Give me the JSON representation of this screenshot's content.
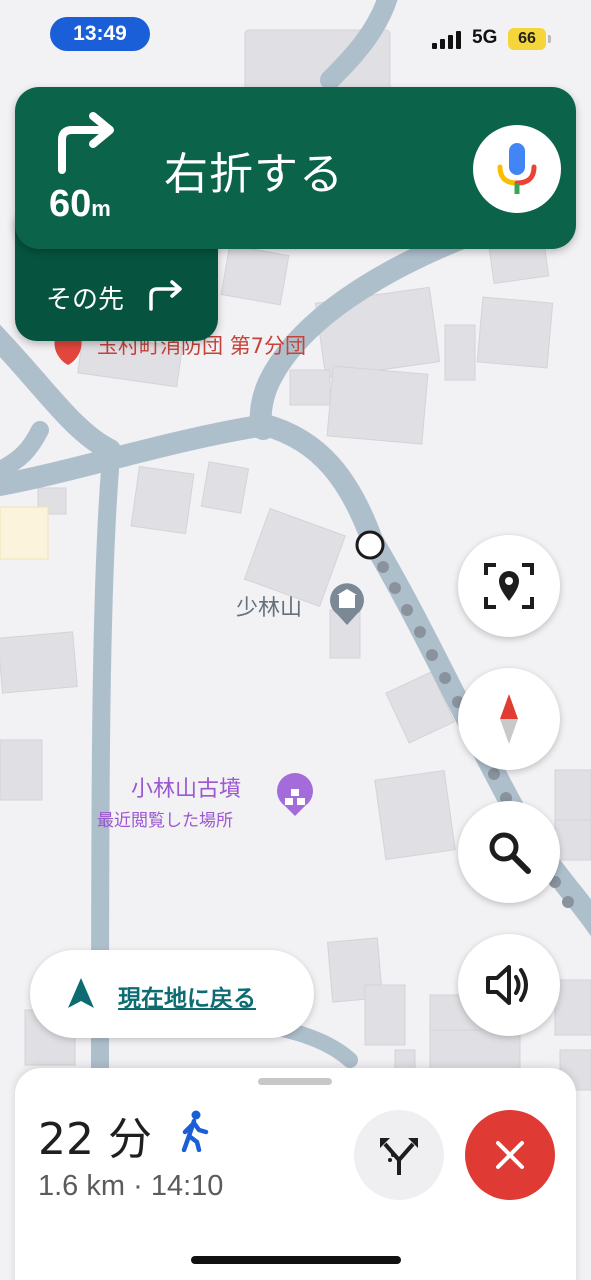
{
  "status_bar": {
    "time": "13:49",
    "network": "5G",
    "battery": "66",
    "colors": {
      "time_pill": "#1a5ed8",
      "battery": "#f5d53a"
    }
  },
  "navigation": {
    "maneuver_icon": "turn-right-icon",
    "distance_value": "60",
    "distance_unit": "m",
    "instruction": "右折する",
    "then_label": "その先",
    "then_icon": "turn-right-icon",
    "mic_icon": "google-mic-icon",
    "colors": {
      "banner": "#0b634a",
      "then_panel": "#065440"
    }
  },
  "map": {
    "poi_red_label": "玉村町消防団 第7分団",
    "poi_temple_label": "少林山",
    "poi_purple_label": "小林山古墳",
    "poi_purple_sublabel": "最近閲覧した場所",
    "colors": {
      "road": "#aebfcc",
      "building": "#e0dfe3",
      "route_dots": "#8a939d",
      "poi_purple": "#a46bdb",
      "poi_red": "#e2473d",
      "poi_gray": "#7b8896"
    }
  },
  "controls": {
    "recenter_label": "現在地に戻る",
    "buttons": [
      "location-pin-focus-icon",
      "compass-icon",
      "search-icon",
      "volume-icon"
    ]
  },
  "trip": {
    "duration": "22 分",
    "mode_icon": "walking-icon",
    "distance": "1.6 km",
    "separator": "·",
    "arrival": "14:10",
    "alt_routes_icon": "alternate-routes-icon",
    "close_icon": "close-icon"
  }
}
